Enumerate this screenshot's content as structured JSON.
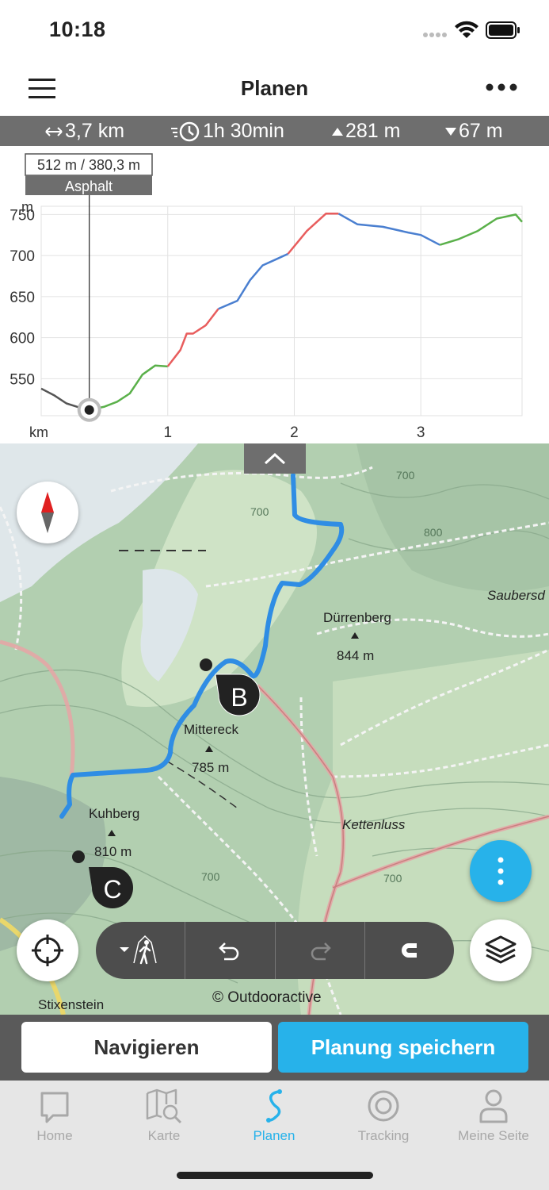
{
  "status": {
    "time": "10:18"
  },
  "header": {
    "title": "Planen"
  },
  "stats": {
    "distance": "3,7 km",
    "duration": "1h 30min",
    "ascent": "281 m",
    "descent": "67 m"
  },
  "chart_data": {
    "type": "line",
    "ylabel": "m",
    "xlabel": "km",
    "x_ticks": [
      "1",
      "2",
      "3"
    ],
    "y_ticks": [
      "550",
      "600",
      "650",
      "700",
      "750"
    ],
    "xlim": [
      0,
      3.8
    ],
    "ylim": [
      505,
      760
    ],
    "tooltip": {
      "value": "512 m / 380,3 m",
      "surface": "Asphalt",
      "x": 0.38
    },
    "series": [
      {
        "name": "",
        "color": "#555555",
        "x": [
          0,
          0.1,
          0.2,
          0.3,
          0.38
        ],
        "y": [
          538,
          530,
          520,
          515,
          512
        ]
      },
      {
        "name": "",
        "color": "#5ab04a",
        "x": [
          0.38,
          0.5,
          0.6,
          0.7,
          0.8,
          0.9,
          1.0
        ],
        "y": [
          512,
          516,
          522,
          532,
          555,
          566,
          565
        ]
      },
      {
        "name": "",
        "color": "#e85d5d",
        "x": [
          1.0,
          1.1,
          1.15,
          1.2,
          1.3,
          1.4
        ],
        "y": [
          565,
          585,
          605,
          605,
          615,
          635
        ]
      },
      {
        "name": "",
        "color": "#4a7fd0",
        "x": [
          1.4,
          1.55,
          1.65,
          1.75,
          1.85,
          1.95
        ],
        "y": [
          635,
          645,
          670,
          688,
          695,
          702
        ]
      },
      {
        "name": "",
        "color": "#e85d5d",
        "x": [
          1.95,
          2.1,
          2.25,
          2.35
        ],
        "y": [
          702,
          730,
          751,
          751
        ]
      },
      {
        "name": "",
        "color": "#4a7fd0",
        "x": [
          2.35,
          2.5,
          2.7,
          2.9,
          3.0,
          3.15
        ],
        "y": [
          751,
          738,
          735,
          728,
          725,
          713
        ]
      },
      {
        "name": "",
        "color": "#5ab04a",
        "x": [
          3.15,
          3.3,
          3.45,
          3.6,
          3.75,
          3.8
        ],
        "y": [
          713,
          720,
          730,
          745,
          750,
          741
        ]
      }
    ]
  },
  "map": {
    "labels": {
      "duerrenberg": "Dürrenberg",
      "duerrenberg_alt": "844 m",
      "mittereck": "Mittereck",
      "mittereck_alt": "785 m",
      "kuhberg": "Kuhberg",
      "kuhberg_alt": "810 m",
      "kettenluss": "Kettenluss",
      "saubers": "Saubersd",
      "stixenstein": "Stixenstein",
      "c700a": "700",
      "c700b": "700",
      "c700c": "700",
      "c700d": "700",
      "c800": "800"
    },
    "waypoints": {
      "b": "B",
      "c": "C"
    },
    "copyright": "© Outdooractive"
  },
  "actions": {
    "navigate": "Navigieren",
    "save": "Planung speichern"
  },
  "tabs": [
    {
      "label": "Home",
      "icon": "home-chat-icon"
    },
    {
      "label": "Karte",
      "icon": "map-search-icon"
    },
    {
      "label": "Planen",
      "icon": "route-plan-icon"
    },
    {
      "label": "Tracking",
      "icon": "tracking-icon"
    },
    {
      "label": "Meine Seite",
      "icon": "person-icon"
    }
  ],
  "colors": {
    "accent": "#27b2ea",
    "route": "#2f8de4",
    "stats_bar": "#6e6e6e"
  }
}
